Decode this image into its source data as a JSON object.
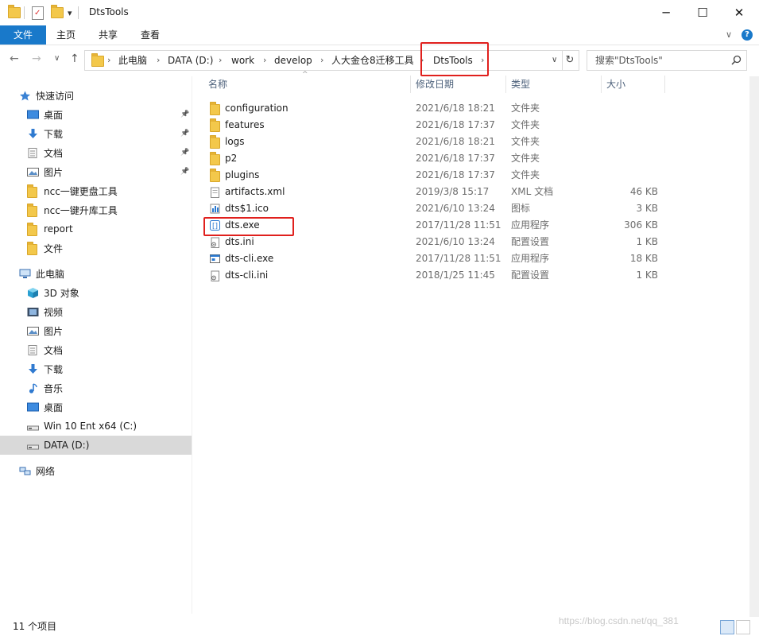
{
  "window": {
    "title": "DtsTools"
  },
  "titlebar": {
    "dropdown": "▾",
    "minimize": "─",
    "maximize": "☐",
    "close": "✕"
  },
  "ribbon": {
    "tabs": [
      "文件",
      "主页",
      "共享",
      "查看"
    ],
    "collapse": "∨",
    "help": "?"
  },
  "address": {
    "breadcrumbs": [
      "此电脑",
      "DATA (D:)",
      "work",
      "develop",
      "人大金仓8迁移工具",
      "DtsTools"
    ],
    "back": "←",
    "forward": "→",
    "recent": "∨",
    "up": "↑",
    "dropdown": "∨",
    "refresh": "↻"
  },
  "search": {
    "placeholder": "搜索\"DtsTools\""
  },
  "columns": {
    "name": "名称",
    "date": "修改日期",
    "type": "类型",
    "size": "大小"
  },
  "sidebar": {
    "quick_access": "快速访问",
    "quick_items": [
      {
        "label": "桌面",
        "icon": "desktop-icon",
        "pinned": true
      },
      {
        "label": "下载",
        "icon": "download-icon",
        "pinned": true
      },
      {
        "label": "文档",
        "icon": "document-icon",
        "pinned": true
      },
      {
        "label": "图片",
        "icon": "picture-icon",
        "pinned": true
      },
      {
        "label": "ncc一键更盘工具",
        "icon": "folder-icon",
        "pinned": false
      },
      {
        "label": "ncc一键升库工具",
        "icon": "folder-icon",
        "pinned": false
      },
      {
        "label": "report",
        "icon": "folder-icon",
        "pinned": false
      },
      {
        "label": "文件",
        "icon": "folder-icon",
        "pinned": false
      }
    ],
    "this_pc": "此电脑",
    "pc_items": [
      {
        "label": "3D 对象",
        "icon": "3d-objects-icon"
      },
      {
        "label": "视频",
        "icon": "video-icon"
      },
      {
        "label": "图片",
        "icon": "picture-icon"
      },
      {
        "label": "文档",
        "icon": "document-icon"
      },
      {
        "label": "下载",
        "icon": "download-icon"
      },
      {
        "label": "音乐",
        "icon": "music-icon"
      },
      {
        "label": "桌面",
        "icon": "desktop-icon"
      },
      {
        "label": "Win 10 Ent x64 (C:)",
        "icon": "drive-icon"
      },
      {
        "label": "DATA (D:)",
        "icon": "drive-icon",
        "selected": true
      }
    ],
    "network": "网络"
  },
  "files": [
    {
      "name": "configuration",
      "date": "2021/6/18 18:21",
      "type": "文件夹",
      "size": "",
      "kind": "folder"
    },
    {
      "name": "features",
      "date": "2021/6/18 17:37",
      "type": "文件夹",
      "size": "",
      "kind": "folder"
    },
    {
      "name": "logs",
      "date": "2021/6/18 18:21",
      "type": "文件夹",
      "size": "",
      "kind": "folder"
    },
    {
      "name": "p2",
      "date": "2021/6/18 17:37",
      "type": "文件夹",
      "size": "",
      "kind": "folder"
    },
    {
      "name": "plugins",
      "date": "2021/6/18 17:37",
      "type": "文件夹",
      "size": "",
      "kind": "folder"
    },
    {
      "name": "artifacts.xml",
      "date": "2019/3/8 15:17",
      "type": "XML 文档",
      "size": "46 KB",
      "kind": "file"
    },
    {
      "name": "dts$1.ico",
      "date": "2021/6/10 13:24",
      "type": "图标",
      "size": "3 KB",
      "kind": "ico"
    },
    {
      "name": "dts.exe",
      "date": "2017/11/28 11:51",
      "type": "应用程序",
      "size": "306 KB",
      "kind": "exe"
    },
    {
      "name": "dts.ini",
      "date": "2021/6/10 13:24",
      "type": "配置设置",
      "size": "1 KB",
      "kind": "ini"
    },
    {
      "name": "dts-cli.exe",
      "date": "2017/11/28 11:51",
      "type": "应用程序",
      "size": "18 KB",
      "kind": "exe2"
    },
    {
      "name": "dts-cli.ini",
      "date": "2018/1/25 11:45",
      "type": "配置设置",
      "size": "1 KB",
      "kind": "ini"
    }
  ],
  "status": {
    "count": "11 个项目"
  },
  "watermark": "https://blog.csdn.net/qq_381",
  "colors": {
    "accent": "#1979ca",
    "highlight": "#e0201d",
    "folder": "#f3c84b",
    "selected": "#d9d9d9"
  }
}
